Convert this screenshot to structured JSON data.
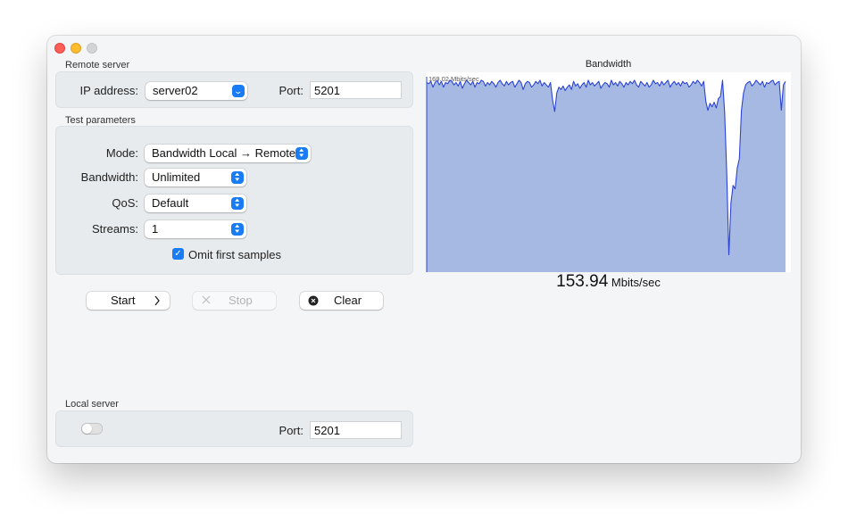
{
  "window": {
    "traffic_lights": [
      "close",
      "minimize",
      "zoom"
    ]
  },
  "remote_server": {
    "section_label": "Remote server",
    "ip_label": "IP address:",
    "ip_value": "server02",
    "port_label": "Port:",
    "port_value": "5201"
  },
  "test_parameters": {
    "section_label": "Test parameters",
    "mode_label": "Mode:",
    "mode_value": "Bandwidth Local → Remote",
    "bandwidth_label": "Bandwidth:",
    "bandwidth_value": "Unlimited",
    "qos_label": "QoS:",
    "qos_value": "Default",
    "streams_label": "Streams:",
    "streams_value": "1",
    "omit_label": "Omit first samples",
    "omit_checked": true
  },
  "actions": {
    "start_label": "Start",
    "stop_label": "Stop",
    "clear_label": "Clear"
  },
  "local_server": {
    "section_label": "Local server",
    "toggle_on": false,
    "port_label": "Port:",
    "port_value": "5201"
  },
  "colors": {
    "accent": "#1a7cf5",
    "chart_fill": "#a6b9e2",
    "chart_line": "#2c44d6"
  },
  "chart_data": {
    "type": "area",
    "title": "Bandwidth",
    "max_label": "169.02 Mbits/sec",
    "ylim": [
      0,
      169.02
    ],
    "unit": "Mbits/sec",
    "values": [
      164,
      163,
      165,
      160,
      164,
      166,
      162,
      165,
      160,
      164,
      163,
      166,
      165,
      162,
      164,
      161,
      165,
      159,
      163,
      166,
      164,
      162,
      165,
      160,
      164,
      163,
      166,
      165,
      161,
      164,
      162,
      165,
      163,
      160,
      164,
      166,
      163,
      161,
      165,
      162,
      164,
      165,
      160,
      163,
      166,
      164,
      158,
      163,
      165,
      164,
      160,
      162,
      165,
      163,
      166,
      161,
      164,
      162,
      160,
      164,
      149,
      139,
      155,
      160,
      158,
      161,
      157,
      160,
      162,
      158,
      165,
      161,
      163,
      159,
      162,
      164,
      160,
      166,
      162,
      164,
      161,
      163,
      165,
      159,
      162,
      164,
      163,
      160,
      166,
      162,
      164,
      161,
      165,
      163,
      160,
      164,
      162,
      165,
      163,
      166,
      162,
      160,
      165,
      163,
      161,
      164,
      160,
      162,
      166,
      163,
      164,
      161,
      165,
      162,
      164,
      166,
      160,
      163,
      165,
      162,
      164,
      161,
      165,
      163,
      164,
      160,
      162,
      165,
      163,
      166,
      164,
      161,
      165,
      148,
      140,
      146,
      143,
      147,
      142,
      150,
      152,
      166,
      138,
      85,
      15,
      60,
      75,
      72,
      90,
      98,
      140,
      155,
      162,
      164,
      165,
      161,
      163,
      166,
      164,
      162,
      165,
      160,
      164,
      163,
      165,
      166,
      162,
      164,
      165,
      140,
      162,
      165
    ]
  },
  "readout": {
    "value": "153.94",
    "unit": "Mbits/sec"
  }
}
